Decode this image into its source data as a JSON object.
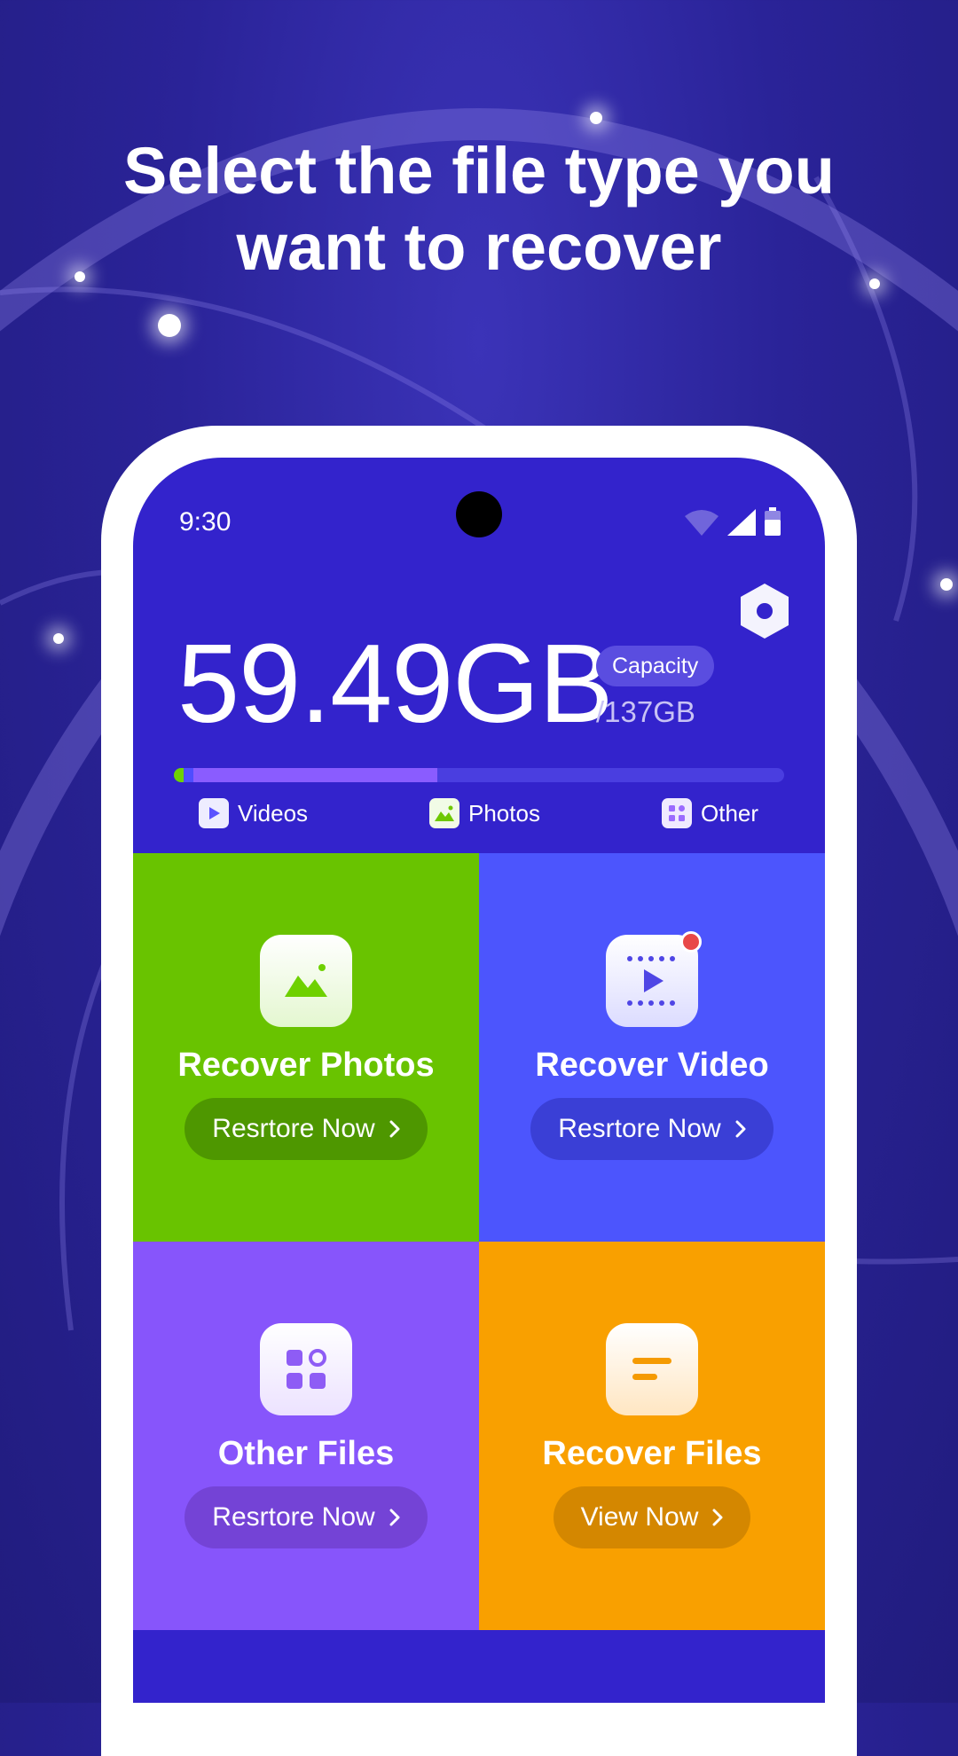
{
  "headline": {
    "line1": "Select the file type you",
    "line2": "want to recover"
  },
  "status_bar": {
    "time": "9:30",
    "icons": [
      "wifi-icon",
      "cell-signal-icon",
      "battery-icon"
    ]
  },
  "storage": {
    "used": "59.49GB",
    "capacity_label": "Capacity",
    "total": "/137GB",
    "bar_fill": {
      "green": 0.016,
      "blue": 0.016,
      "purple": 0.4
    }
  },
  "legend": [
    {
      "label": "Videos",
      "icon": "video-icon",
      "color": "#6f66ff"
    },
    {
      "label": "Photos",
      "icon": "photo-icon",
      "color": "#7ed321"
    },
    {
      "label": "Other",
      "icon": "grid-icon",
      "color": "#a68bff"
    }
  ],
  "tiles": [
    {
      "title": "Recover Photos",
      "button": "Resrtore Now",
      "color": "#69c300",
      "button_color": "#4e9700",
      "icon": "photo-icon"
    },
    {
      "title": "Recover Video",
      "button": "Resrtore Now",
      "color": "#4c55fd",
      "button_color": "#3a3fd6",
      "icon": "video-icon",
      "badge": true
    },
    {
      "title": "Other Files",
      "button": "Resrtore Now",
      "color": "#8755fb",
      "button_color": "#7443d6",
      "icon": "grid-icon"
    },
    {
      "title": "Recover Files",
      "button": "View Now",
      "color": "#f9a000",
      "button_color": "#d48700",
      "icon": "document-icon"
    }
  ],
  "colors": {
    "screen": "#3323cc",
    "background": "#2a2398"
  }
}
